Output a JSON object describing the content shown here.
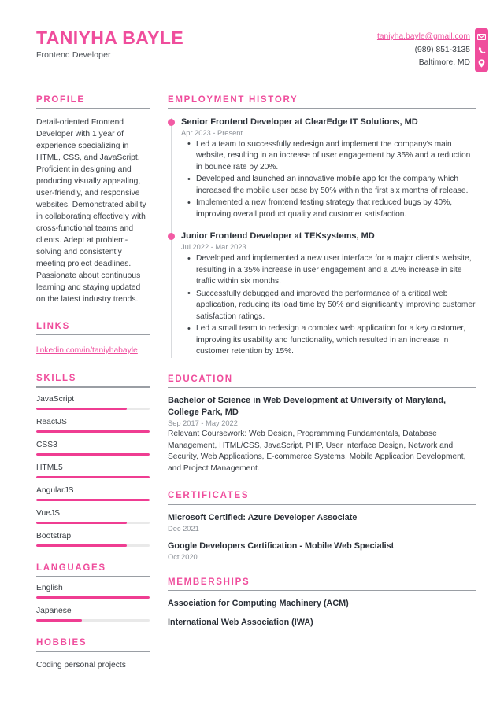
{
  "theme": {
    "accent_pink": "#ef4d9c",
    "bar_pink": "#ef3d92",
    "bar_track": "#e9e9e9",
    "rule_gray": "#9a9ea4",
    "text_dark": "#2b3038",
    "text_body": "#3a3f45",
    "text_muted": "#8b9097"
  },
  "header": {
    "full_name": "TANIYHA BAYLE",
    "job_title": "Frontend Developer",
    "contact": {
      "email": "taniyha.bayle@gmail.com",
      "phone": "(989) 851-3135",
      "location": "Baltimore, MD"
    },
    "icons": [
      "envelope-icon",
      "phone-icon",
      "location-pin-icon"
    ]
  },
  "left_column": {
    "profile": {
      "title": "PROFILE",
      "text": "Detail-oriented Frontend Developer with 1 year of experience specializing in HTML, CSS, and JavaScript. Proficient in designing and producing visually appealing, user-friendly, and responsive websites. Demonstrated ability in collaborating effectively with cross-functional teams and clients. Adept at problem-solving and consistently meeting project deadlines. Passionate about continuous learning and staying updated on the latest industry trends."
    },
    "links": {
      "title": "LINKS",
      "items": [
        {
          "label": "linkedin.com/in/taniyhabayle"
        }
      ]
    },
    "skills": {
      "title": "SKILLS",
      "items": [
        {
          "label": "JavaScript",
          "level": 80
        },
        {
          "label": "ReactJS",
          "level": 100
        },
        {
          "label": "CSS3",
          "level": 100
        },
        {
          "label": "HTML5",
          "level": 100
        },
        {
          "label": "AngularJS",
          "level": 100
        },
        {
          "label": "VueJS",
          "level": 80
        },
        {
          "label": "Bootstrap",
          "level": 80
        }
      ]
    },
    "languages": {
      "title": "LANGUAGES",
      "items": [
        {
          "label": "English",
          "level": 100
        },
        {
          "label": "Japanese",
          "level": 40
        }
      ]
    },
    "hobbies": {
      "title": "HOBBIES",
      "items": [
        {
          "label": "Coding personal projects"
        }
      ]
    }
  },
  "right_column": {
    "employment": {
      "title": "EMPLOYMENT HISTORY",
      "jobs": [
        {
          "heading": "Senior Frontend Developer at ClearEdge IT Solutions, MD",
          "date": "Apr 2023 - Present",
          "bullets": [
            "Led a team to successfully redesign and implement the company's main website, resulting in an increase of user engagement by 35% and a reduction in bounce rate by 20%.",
            "Developed and launched an innovative mobile app for the company which increased the mobile user base by 50% within the first six months of release.",
            "Implemented a new frontend testing strategy that reduced bugs by 40%, improving overall product quality and customer satisfaction."
          ]
        },
        {
          "heading": "Junior Frontend Developer at TEKsystems, MD",
          "date": "Jul 2022 - Mar 2023",
          "bullets": [
            "Developed and implemented a new user interface for a major client's website, resulting in a 35% increase in user engagement and a 20% increase in site traffic within six months.",
            "Successfully debugged and improved the performance of a critical web application, reducing its load time by 50% and significantly improving customer satisfaction ratings.",
            "Led a small team to redesign a complex web application for a key customer, improving its usability and functionality, which resulted in an increase in customer retention by 15%."
          ]
        }
      ]
    },
    "education": {
      "title": "EDUCATION",
      "items": [
        {
          "heading": "Bachelor of Science in Web Development at University of Maryland, College Park, MD",
          "date": "Sep 2017 - May 2022",
          "description": "Relevant Coursework: Web Design, Programming Fundamentals, Database Management, HTML/CSS, JavaScript, PHP, User Interface Design, Network and Security, Web Applications, E-commerce Systems, Mobile Application Development, and Project Management."
        }
      ]
    },
    "certificates": {
      "title": "CERTIFICATES",
      "items": [
        {
          "name": "Microsoft Certified: Azure Developer Associate",
          "date": "Dec 2021"
        },
        {
          "name": "Google Developers Certification - Mobile Web Specialist",
          "date": "Oct 2020"
        }
      ]
    },
    "memberships": {
      "title": "MEMBERSHIPS",
      "items": [
        {
          "name": "Association for Computing Machinery (ACM)"
        },
        {
          "name": "International Web Association (IWA)"
        }
      ]
    }
  }
}
